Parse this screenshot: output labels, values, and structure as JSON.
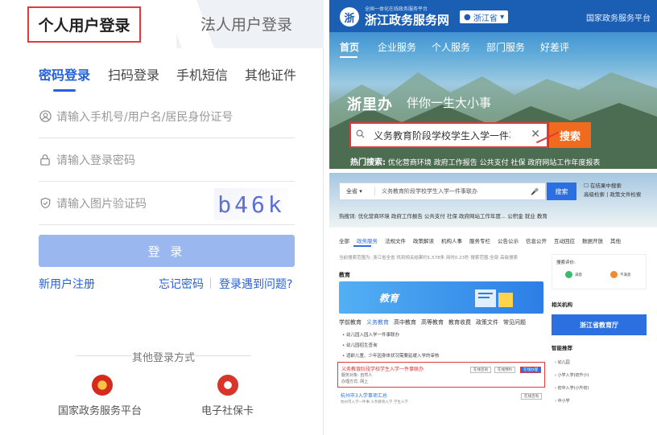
{
  "login": {
    "tab_personal": "个人用户登录",
    "tab_legal": "法人用户登录",
    "methods": [
      "密码登录",
      "扫码登录",
      "手机短信",
      "其他证件"
    ],
    "username_placeholder": "请输入手机号/用户名/居民身份证号",
    "password_placeholder": "请输入登录密码",
    "captcha_placeholder": "请输入图片验证码",
    "captcha_text": "b46k",
    "login_button": "登 录",
    "register_link": "新用户注册",
    "forgot_link": "忘记密码",
    "problem_link": "登录遇到问题?",
    "other_title": "其他登录方式",
    "other_national": "国家政务服务平台",
    "other_social": "电子社保卡"
  },
  "portal": {
    "logo_char": "浙",
    "site_subtitle": "全国一体化在线政务服务平台",
    "site_title": "浙江政务服务网",
    "region": "浙江省",
    "national_link": "国家政务服务平台",
    "nav": [
      "首页",
      "企业服务",
      "个人服务",
      "部门服务",
      "好差评"
    ],
    "slogan": "浙里办",
    "slogan2": "伴你一生大小事",
    "search_value": "义务教育阶段学校学生入学一件事联办",
    "search_button": "搜索",
    "hot_label": "热门搜索:",
    "hot_items": "优化营商环境  政府工作报告  公共支付  社保  政府网站工作年度报表"
  },
  "results": {
    "scope": "全省",
    "query": "义务教育阶段学校学生入学一件事联办",
    "search_button": "搜索",
    "opt_in_results": "在结果中搜索",
    "opt_links": "高级检索 | 政策文件检索",
    "hot": "热搜词:  优化营商环境  政府工作报告  公共支付  社保  政府网站工作年度...  公积金  就业  教育",
    "tabs": [
      "全部",
      "政务服务",
      "法规文件",
      "政策解读",
      "机构人事",
      "服务专栏",
      "公告公示",
      "信息公开",
      "互动回应",
      "数据开放",
      "其他"
    ],
    "info": "当前搜索范围为: 浙江省全省  找到相关结果约1,578条  用时0.23秒  搜索范围:全部  高级搜索",
    "section": "教育",
    "edu_banner": "教育",
    "edu_tabs": [
      "学前教育",
      "义务教育",
      "高中教育",
      "高等教育",
      "教育收费",
      "政策文件",
      "常见问题"
    ],
    "bullets": [
      "幼儿园入园入学一件事联办",
      "幼儿园招生查询",
      "适龄儿童、少年因身体状况需要延缓入学的审核"
    ],
    "result_title": "义务教育阶段学校学生入学一件事联办",
    "result_meta1": "服务对象: 自然人",
    "result_meta2": "办理方式: 网上",
    "tag1": "在线咨询",
    "tag2": "在线预约",
    "tag3": "在线办理",
    "result2": "杭州市3入学事项汇总",
    "result2_meta": "杭州市入学一件事  义务教育入学  学生入学",
    "result2_tag": "在线咨询",
    "feedback_title": "搜索评价:",
    "feedback_good": "满意",
    "feedback_bad": "不满意",
    "related_title": "相关机构",
    "edu_dept": "浙江省教育厅",
    "smart_title": "智能推荐",
    "smart_items": [
      "幼儿园",
      "小学入学(初升小)",
      "初中入学(小升初)",
      "中小学"
    ]
  },
  "colors": {
    "primary": "#2561d8",
    "highlight": "#e23a3a",
    "search_orange": "#f06b1e"
  }
}
